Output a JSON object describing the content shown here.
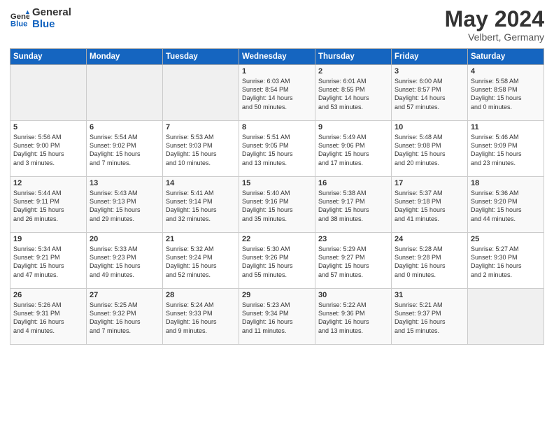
{
  "header": {
    "logo_line1": "General",
    "logo_line2": "Blue",
    "month": "May 2024",
    "location": "Velbert, Germany"
  },
  "days_of_week": [
    "Sunday",
    "Monday",
    "Tuesday",
    "Wednesday",
    "Thursday",
    "Friday",
    "Saturday"
  ],
  "weeks": [
    [
      {
        "day": "",
        "info": ""
      },
      {
        "day": "",
        "info": ""
      },
      {
        "day": "",
        "info": ""
      },
      {
        "day": "1",
        "info": "Sunrise: 6:03 AM\nSunset: 8:54 PM\nDaylight: 14 hours\nand 50 minutes."
      },
      {
        "day": "2",
        "info": "Sunrise: 6:01 AM\nSunset: 8:55 PM\nDaylight: 14 hours\nand 53 minutes."
      },
      {
        "day": "3",
        "info": "Sunrise: 6:00 AM\nSunset: 8:57 PM\nDaylight: 14 hours\nand 57 minutes."
      },
      {
        "day": "4",
        "info": "Sunrise: 5:58 AM\nSunset: 8:58 PM\nDaylight: 15 hours\nand 0 minutes."
      }
    ],
    [
      {
        "day": "5",
        "info": "Sunrise: 5:56 AM\nSunset: 9:00 PM\nDaylight: 15 hours\nand 3 minutes."
      },
      {
        "day": "6",
        "info": "Sunrise: 5:54 AM\nSunset: 9:02 PM\nDaylight: 15 hours\nand 7 minutes."
      },
      {
        "day": "7",
        "info": "Sunrise: 5:53 AM\nSunset: 9:03 PM\nDaylight: 15 hours\nand 10 minutes."
      },
      {
        "day": "8",
        "info": "Sunrise: 5:51 AM\nSunset: 9:05 PM\nDaylight: 15 hours\nand 13 minutes."
      },
      {
        "day": "9",
        "info": "Sunrise: 5:49 AM\nSunset: 9:06 PM\nDaylight: 15 hours\nand 17 minutes."
      },
      {
        "day": "10",
        "info": "Sunrise: 5:48 AM\nSunset: 9:08 PM\nDaylight: 15 hours\nand 20 minutes."
      },
      {
        "day": "11",
        "info": "Sunrise: 5:46 AM\nSunset: 9:09 PM\nDaylight: 15 hours\nand 23 minutes."
      }
    ],
    [
      {
        "day": "12",
        "info": "Sunrise: 5:44 AM\nSunset: 9:11 PM\nDaylight: 15 hours\nand 26 minutes."
      },
      {
        "day": "13",
        "info": "Sunrise: 5:43 AM\nSunset: 9:13 PM\nDaylight: 15 hours\nand 29 minutes."
      },
      {
        "day": "14",
        "info": "Sunrise: 5:41 AM\nSunset: 9:14 PM\nDaylight: 15 hours\nand 32 minutes."
      },
      {
        "day": "15",
        "info": "Sunrise: 5:40 AM\nSunset: 9:16 PM\nDaylight: 15 hours\nand 35 minutes."
      },
      {
        "day": "16",
        "info": "Sunrise: 5:38 AM\nSunset: 9:17 PM\nDaylight: 15 hours\nand 38 minutes."
      },
      {
        "day": "17",
        "info": "Sunrise: 5:37 AM\nSunset: 9:18 PM\nDaylight: 15 hours\nand 41 minutes."
      },
      {
        "day": "18",
        "info": "Sunrise: 5:36 AM\nSunset: 9:20 PM\nDaylight: 15 hours\nand 44 minutes."
      }
    ],
    [
      {
        "day": "19",
        "info": "Sunrise: 5:34 AM\nSunset: 9:21 PM\nDaylight: 15 hours\nand 47 minutes."
      },
      {
        "day": "20",
        "info": "Sunrise: 5:33 AM\nSunset: 9:23 PM\nDaylight: 15 hours\nand 49 minutes."
      },
      {
        "day": "21",
        "info": "Sunrise: 5:32 AM\nSunset: 9:24 PM\nDaylight: 15 hours\nand 52 minutes."
      },
      {
        "day": "22",
        "info": "Sunrise: 5:30 AM\nSunset: 9:26 PM\nDaylight: 15 hours\nand 55 minutes."
      },
      {
        "day": "23",
        "info": "Sunrise: 5:29 AM\nSunset: 9:27 PM\nDaylight: 15 hours\nand 57 minutes."
      },
      {
        "day": "24",
        "info": "Sunrise: 5:28 AM\nSunset: 9:28 PM\nDaylight: 16 hours\nand 0 minutes."
      },
      {
        "day": "25",
        "info": "Sunrise: 5:27 AM\nSunset: 9:30 PM\nDaylight: 16 hours\nand 2 minutes."
      }
    ],
    [
      {
        "day": "26",
        "info": "Sunrise: 5:26 AM\nSunset: 9:31 PM\nDaylight: 16 hours\nand 4 minutes."
      },
      {
        "day": "27",
        "info": "Sunrise: 5:25 AM\nSunset: 9:32 PM\nDaylight: 16 hours\nand 7 minutes."
      },
      {
        "day": "28",
        "info": "Sunrise: 5:24 AM\nSunset: 9:33 PM\nDaylight: 16 hours\nand 9 minutes."
      },
      {
        "day": "29",
        "info": "Sunrise: 5:23 AM\nSunset: 9:34 PM\nDaylight: 16 hours\nand 11 minutes."
      },
      {
        "day": "30",
        "info": "Sunrise: 5:22 AM\nSunset: 9:36 PM\nDaylight: 16 hours\nand 13 minutes."
      },
      {
        "day": "31",
        "info": "Sunrise: 5:21 AM\nSunset: 9:37 PM\nDaylight: 16 hours\nand 15 minutes."
      },
      {
        "day": "",
        "info": ""
      }
    ]
  ]
}
